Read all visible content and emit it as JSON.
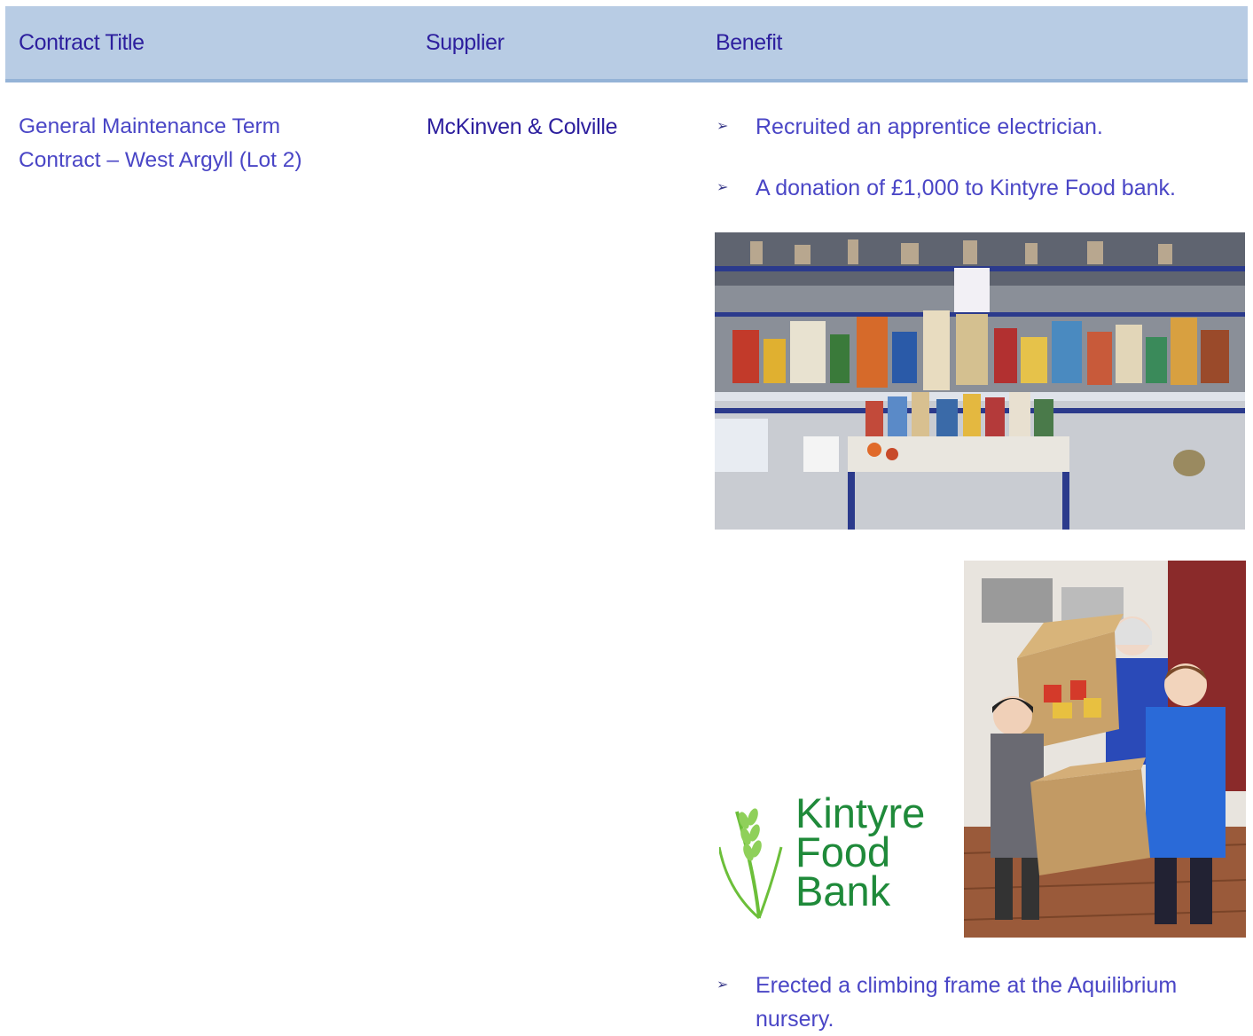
{
  "table": {
    "headers": [
      "Contract Title",
      "Supplier",
      "Benefit"
    ],
    "row": {
      "contract_title": "General Maintenance Term Contract – West Argyll (Lot 2)",
      "supplier": "McKinven & Colville",
      "benefits": [
        "Recruited an apprentice electrician.",
        "A donation of £1,000 to Kintyre Food bank.",
        "Erected a climbing frame at the Aquilibrium nursery."
      ]
    }
  },
  "bullet_glyph": "➢",
  "logo": {
    "lines": [
      "Kintyre",
      "Food",
      "Bank"
    ],
    "color": "#1f8a3a"
  },
  "colors": {
    "header_bg": "#b8cce4",
    "header_text": "#2d1f9e",
    "body_text": "#4a46c6"
  }
}
